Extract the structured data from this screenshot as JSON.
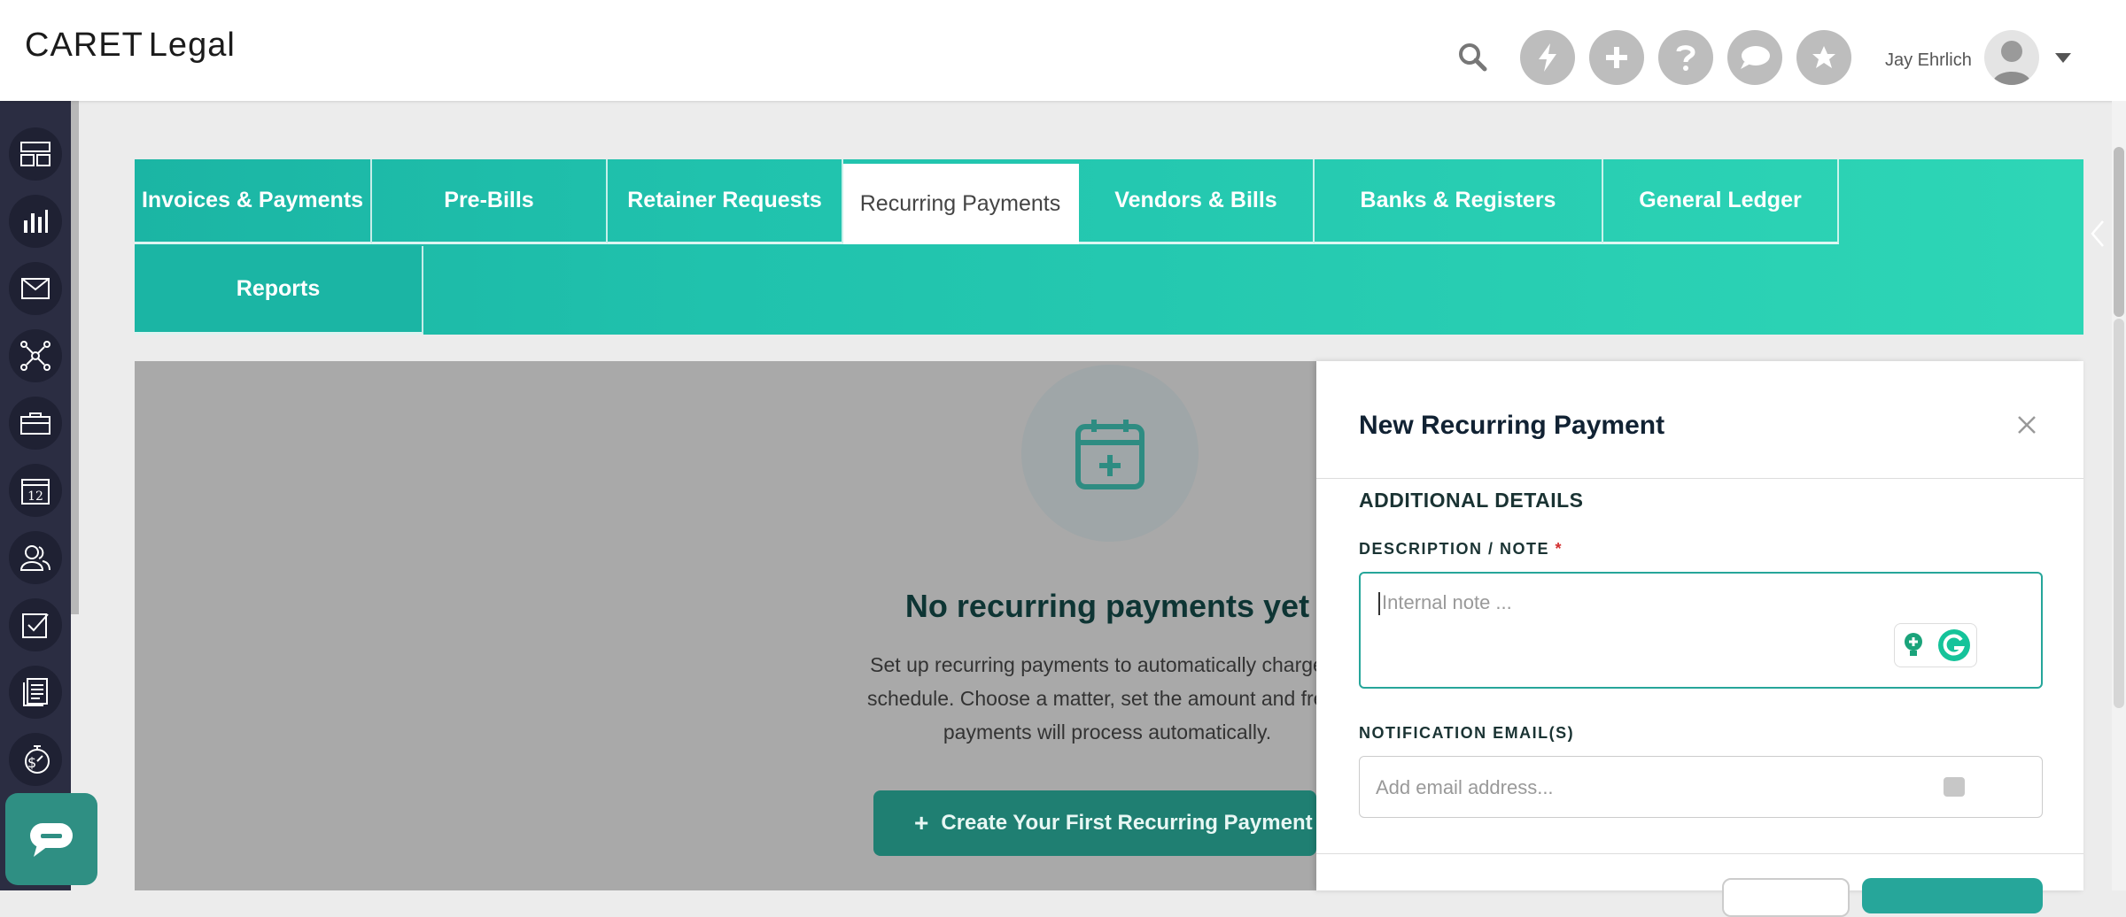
{
  "header": {
    "logo_brand": "CARET",
    "logo_product": "Legal",
    "user_name": "Jay Ehrlich"
  },
  "tabs": [
    {
      "label": "Invoices & Payments"
    },
    {
      "label": "Pre-Bills"
    },
    {
      "label": "Retainer Requests"
    },
    {
      "label": "Recurring Payments",
      "active": true
    },
    {
      "label": "Vendors & Bills"
    },
    {
      "label": "Banks & Registers"
    },
    {
      "label": "General Ledger"
    },
    {
      "label": "Reports"
    }
  ],
  "empty_state": {
    "title": "No recurring payments yet",
    "desc_line1": "Set up recurring payments to automatically charge cl",
    "desc_line2": "schedule. Choose a matter, set the amount and frequ",
    "desc_line3": "payments will process automatically.",
    "button_label": "Create Your First Recurring Payment"
  },
  "drawer": {
    "title": "New Recurring Payment",
    "section": "ADDITIONAL DETAILS",
    "description_label": "DESCRIPTION / NOTE",
    "required_mark": "*",
    "description_placeholder": "Internal note ...",
    "email_label": "NOTIFICATION EMAIL(S)",
    "email_placeholder": "Add email address..."
  },
  "colors": {
    "teal_primary": "#26a69a",
    "teal_tab": "#20c2ad",
    "nav_bg": "#2b2d42",
    "cta_button": "#1f7f72"
  }
}
